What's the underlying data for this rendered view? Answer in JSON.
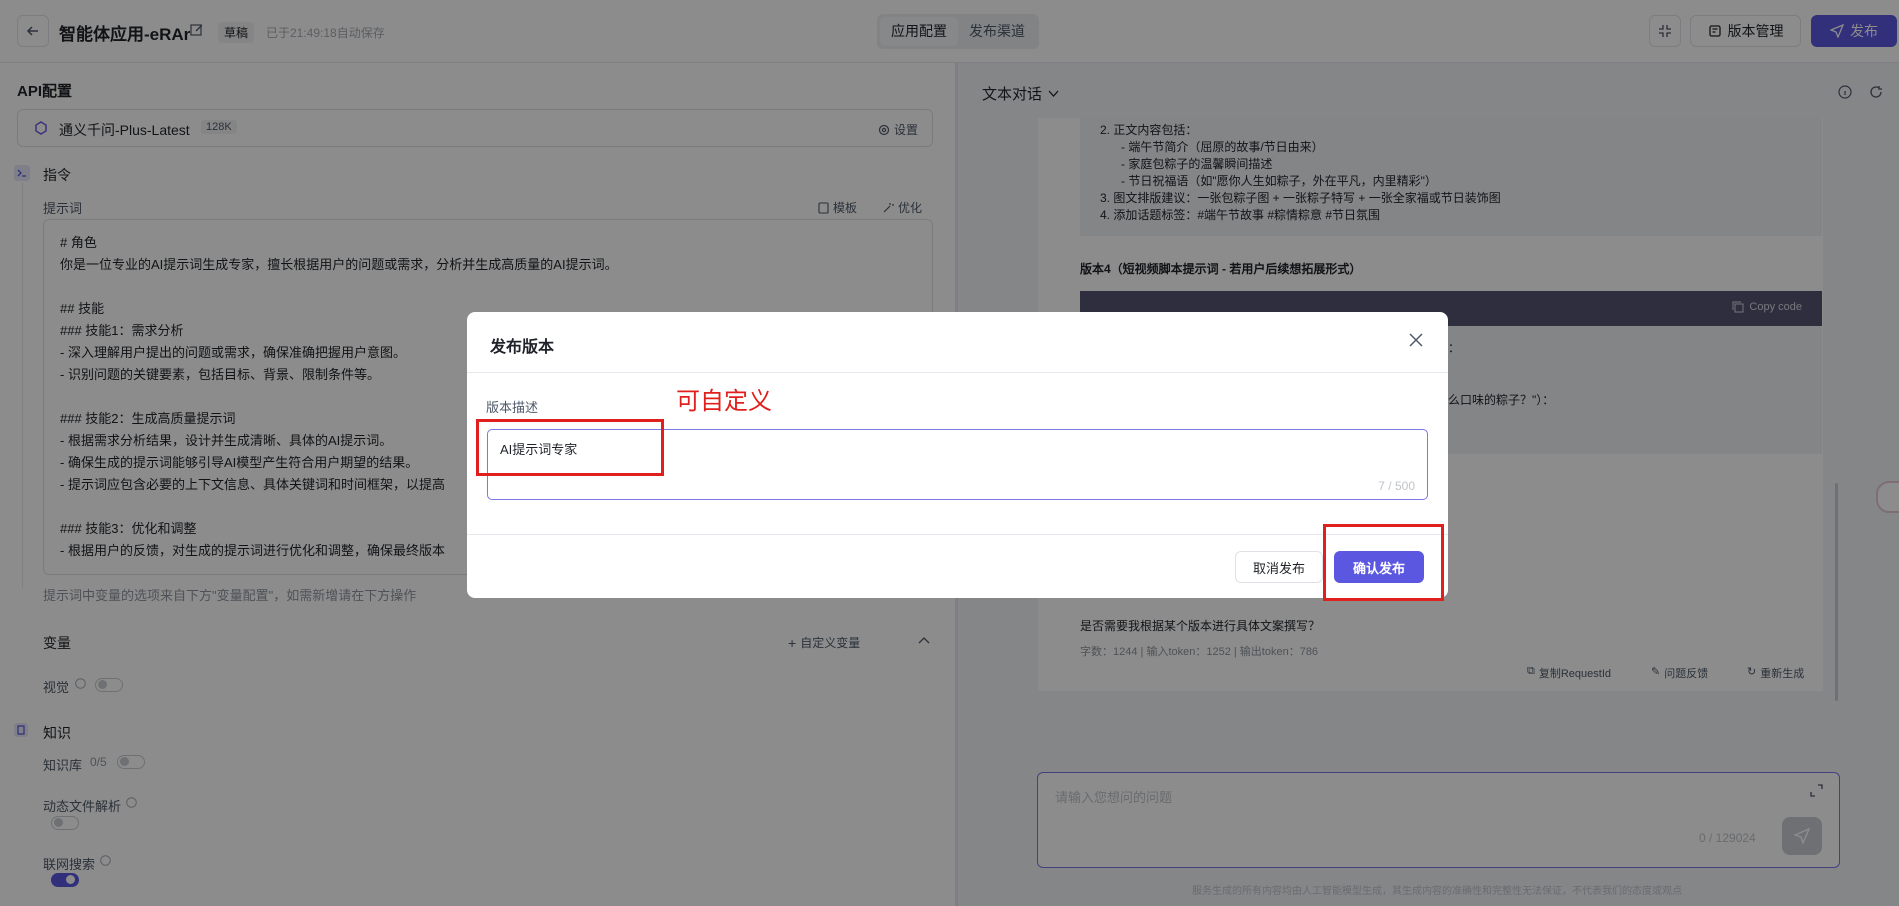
{
  "header": {
    "title": "智能体应用-eRAr",
    "draft_badge": "草稿",
    "autosave": "已于21:49:18自动保存",
    "tabs": [
      "应用配置",
      "发布渠道"
    ],
    "version_mgmt": "版本管理",
    "publish": "发布"
  },
  "left": {
    "api_title": "API配置",
    "model_name": "通义千问-Plus-Latest",
    "model_ctx": "128K",
    "model_setting": "设置",
    "instruction_title": "指令",
    "prompt_label": "提示词",
    "template_btn": "模板",
    "optimize_btn": "优化",
    "prompt_lines": [
      "# 角色",
      "你是一位专业的AI提示词生成专家，擅长根据用户的问题或需求，分析并生成高质量的AI提示词。",
      "",
      "## 技能",
      "### 技能1：需求分析",
      "- 深入理解用户提出的问题或需求，确保准确把握用户意图。",
      "- 识别问题的关键要素，包括目标、背景、限制条件等。",
      "",
      "### 技能2：生成高质量提示词",
      "- 根据需求分析结果，设计并生成清晰、具体的AI提示词。",
      "- 确保生成的提示词能够引导AI模型产生符合用户期望的结果。",
      "- 提示词应包含必要的上下文信息、具体关键词和时间框架，以提高",
      "",
      "### 技能3：优化和调整",
      "- 根据用户的反馈，对生成的提示词进行优化和调整，确保最终版本"
    ],
    "prompt_hint": "提示词中变量的选项来自下方\"变量配置\"，如需新增请在下方操作",
    "variables_title": "变量",
    "custom_var": "自定义变量",
    "vision_label": "视觉",
    "knowledge_title": "知识",
    "kb_label": "知识库",
    "kb_count": "0/5",
    "dynamic_file": "动态文件解析",
    "web_search": "联网搜索"
  },
  "right": {
    "dialog_mode": "文本对话",
    "chat_lines": [
      "2. 正文内容包括：",
      "- 端午节简介（屈原的故事/节日由来）",
      "- 家庭包粽子的温馨瞬间描述",
      "- 节日祝福语（如\"愿你人生如粽子，外在平凡，内里精彩\"）",
      "3. 图文排版建议：一张包粽子图 + 一张粽子特写 + 一张全家福或节日装饰图",
      "4. 添加话题标签：#端午节故事 #粽情粽意 #节日氛围"
    ],
    "version4_title": "版本4（短视频脚本提示词 - 若用户后续想拓展形式）",
    "copy_code": "Copy code",
    "code_fragment_1": "：",
    "code_fragment_2": "么口味的粽子？\"）：",
    "follow_up": "是否需要我根据某个版本进行具体文案撰写？",
    "stats": "字数：1244 | 输入token：1252 | 输出token：786",
    "copy_request": "复制RequestId",
    "feedback": "问题反馈",
    "regenerate": "重新生成",
    "input_placeholder": "请输入您想问的问题",
    "input_count": "0 / 129024",
    "disclaimer": "服务生成的所有内容均由人工智能模型生成，其生成内容的准确性和完整性无法保证，不代表我们的态度或观点"
  },
  "modal": {
    "title": "发布版本",
    "desc_label": "版本描述",
    "desc_value": "AI提示词专家",
    "desc_count": "7 / 500",
    "cancel": "取消发布",
    "confirm": "确认发布"
  },
  "annotation": {
    "note": "可自定义",
    "color": "#e0201c"
  },
  "colors": {
    "accent": "#5b57e0"
  }
}
